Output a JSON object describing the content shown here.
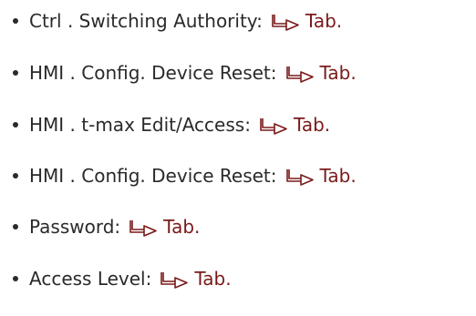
{
  "icon": "link-arrow-icon",
  "colors": {
    "text": "#2a2a2a",
    "link": "#7a1a1a"
  },
  "items": [
    {
      "label": "Ctrl . Switching Authority:",
      "link": "Tab."
    },
    {
      "label": "HMI . Config. Device Reset:",
      "link": "Tab."
    },
    {
      "label": "HMI . t-max Edit/Access:",
      "link": "Tab."
    },
    {
      "label": "HMI . Config. Device Reset:",
      "link": "Tab."
    },
    {
      "label": "Password:",
      "link": "Tab."
    },
    {
      "label": "Access Level:",
      "link": "Tab."
    }
  ]
}
